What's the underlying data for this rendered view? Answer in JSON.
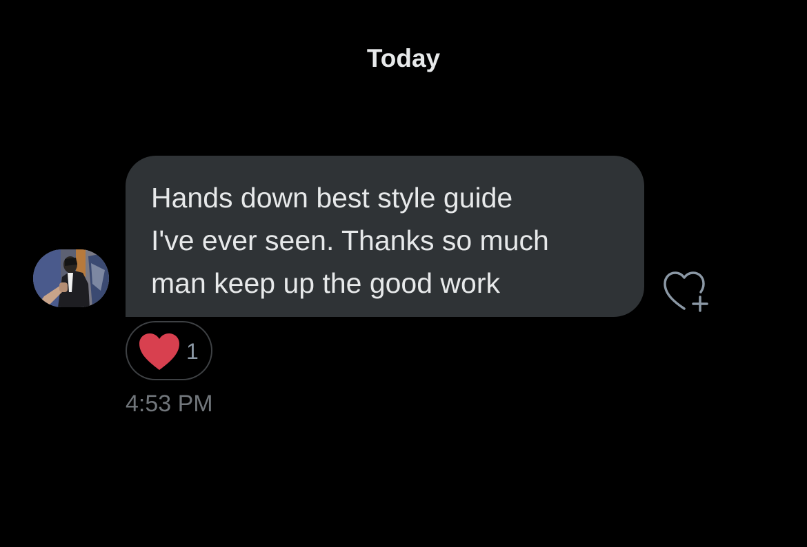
{
  "conversation": {
    "date_divider": "Today"
  },
  "message": {
    "lines": [
      "Hands down best style guide",
      "I've ever seen. Thanks so much",
      "man keep up the good work"
    ],
    "timestamp": "4:53 PM",
    "reaction": {
      "icon": "red-heart-icon",
      "count": "1"
    }
  },
  "sender": {
    "avatar": "profile-photo"
  },
  "actions": {
    "add_reaction_icon": "heart-plus-icon"
  },
  "colors": {
    "background": "#000000",
    "bubble": "#2f3336",
    "text": "#e7e9ea",
    "muted_text": "#71767b",
    "heart_red": "#d8404f"
  }
}
